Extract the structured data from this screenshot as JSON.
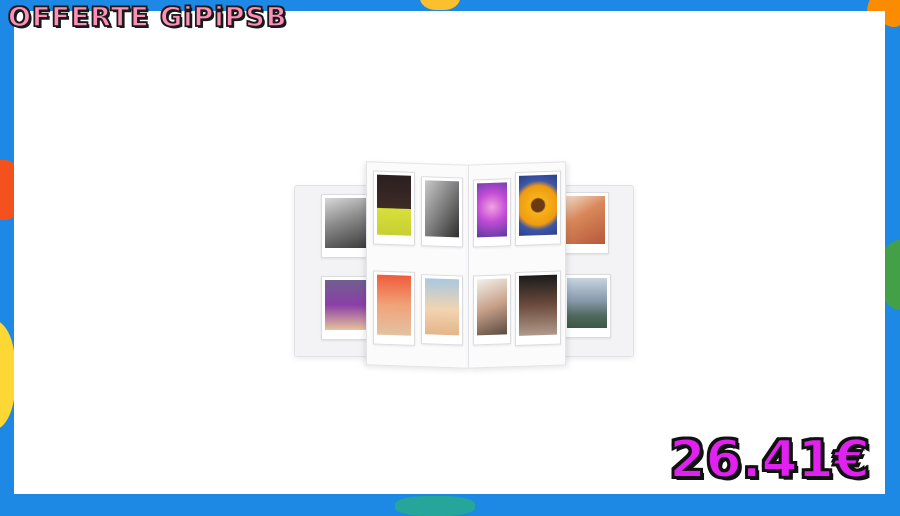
{
  "brand": {
    "title": "OFFERTE GiPiPSB"
  },
  "price": {
    "value": "26.41€"
  },
  "colors": {
    "background_blue": "#1e88e5",
    "panel": "#ffffff",
    "title_fill": "#ff8fb8",
    "price_fill": "#e021f0",
    "outline": "#111111"
  },
  "product": {
    "photos": [
      {
        "subject": "black-and-white-dog"
      },
      {
        "subject": "girl-in-yellow"
      },
      {
        "subject": "black-and-white-cat"
      },
      {
        "subject": "purple-flower"
      },
      {
        "subject": "sunflower"
      },
      {
        "subject": "redhead-portrait"
      },
      {
        "subject": "kids-with-balloon"
      },
      {
        "subject": "girl-orange-background"
      },
      {
        "subject": "beach-scene"
      },
      {
        "subject": "couple-portrait"
      },
      {
        "subject": "people-indoors"
      },
      {
        "subject": "mountain-landscape"
      }
    ]
  }
}
